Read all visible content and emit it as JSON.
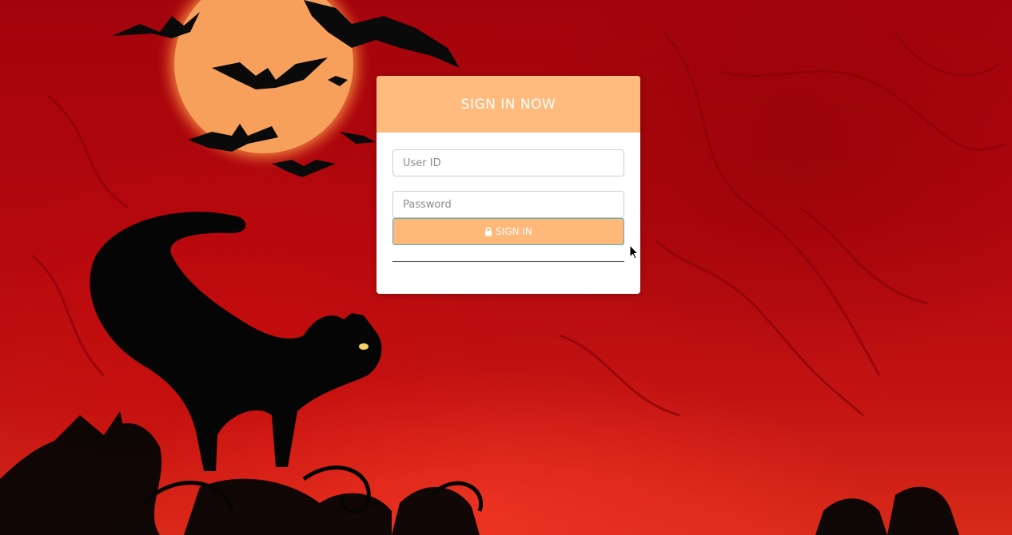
{
  "login": {
    "title": "SIGN IN NOW",
    "user_id_placeholder": "User ID",
    "user_id_value": "",
    "password_placeholder": "Password",
    "password_value": "",
    "signin_label": "SIGN IN"
  },
  "icons": {
    "lock": "lock-icon",
    "cursor": "mouse-pointer-icon"
  },
  "colors": {
    "header": "#ffbb7d",
    "button": "#ffb87a",
    "button_border": "#4fb0b0",
    "background": "#b3080e"
  }
}
